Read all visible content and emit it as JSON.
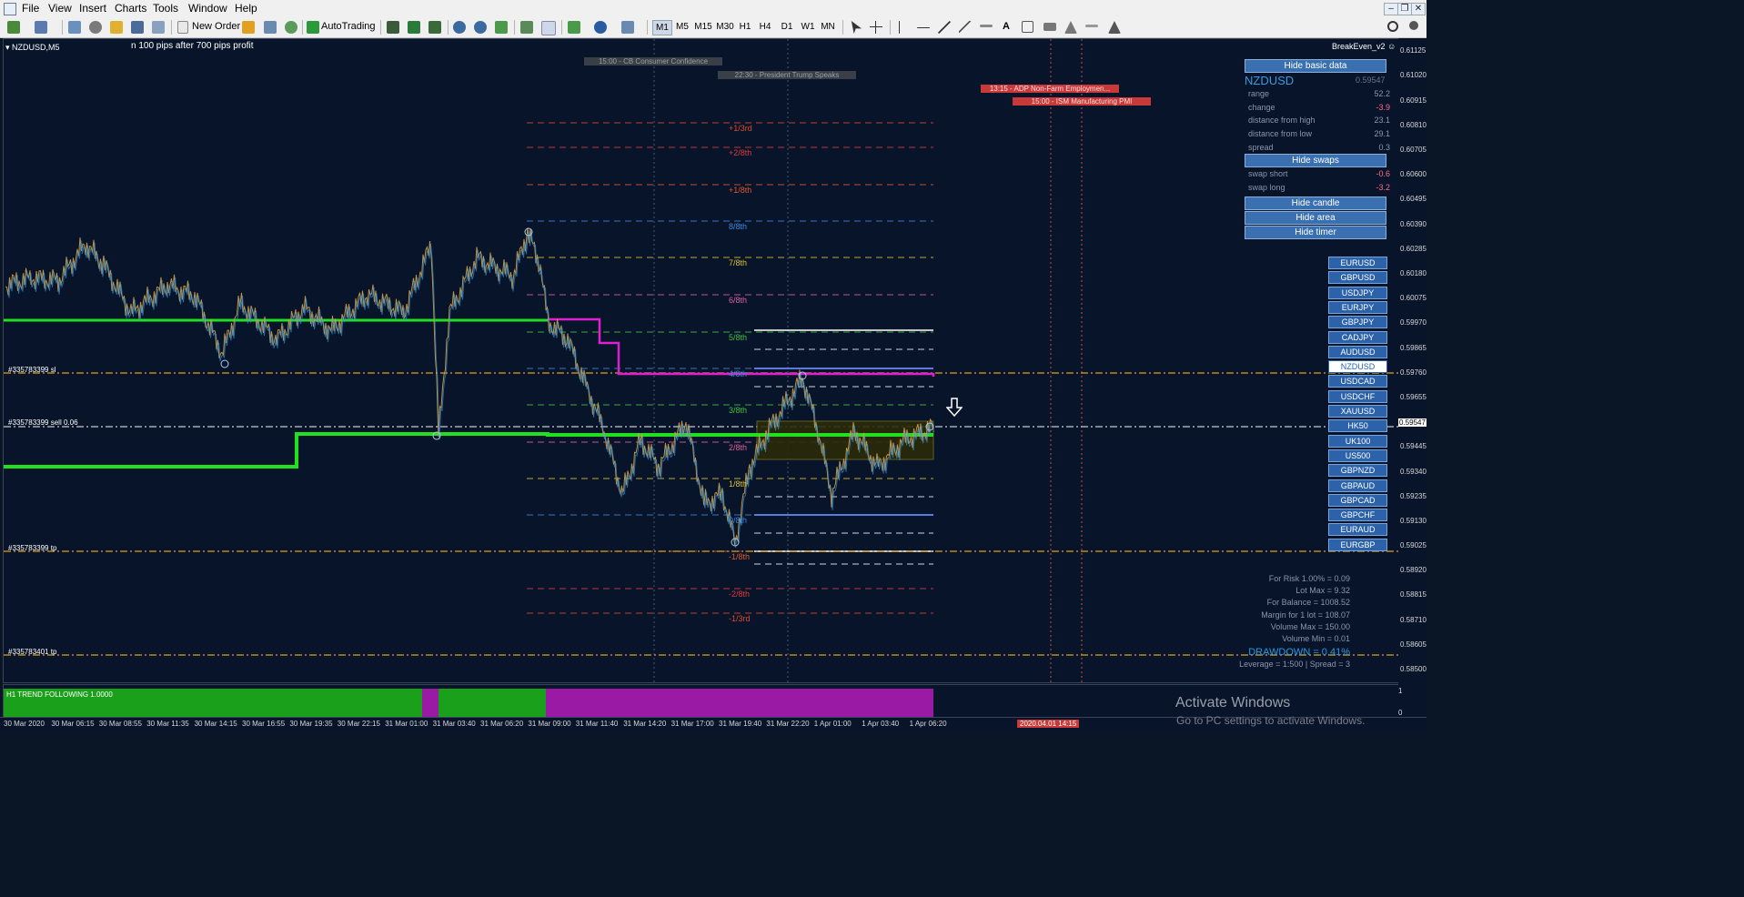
{
  "menubar": {
    "items": [
      "File",
      "View",
      "Insert",
      "Charts",
      "Tools",
      "Window",
      "Help"
    ]
  },
  "toolbar": {
    "new_order": "New Order",
    "autotrading": "AutoTrading",
    "timeframes": [
      "M1",
      "M5",
      "M15",
      "M30",
      "H1",
      "H4",
      "D1",
      "W1",
      "MN"
    ]
  },
  "chart": {
    "symbol_label": "NZDUSD,M5",
    "comment": "n 100 pips after 700 pips profit",
    "indicator_name": "BreakEven_v2",
    "order_labels": {
      "sl": "#335783399 sl",
      "sell": "#335783399 sell 0.06",
      "tp1": "#335783399 tp",
      "tp2": "#335783401 tp"
    },
    "events": [
      {
        "text": "15:00 - CB Consumer Confidence",
        "color": "#3a3f47",
        "text_color": "#9aa0a8"
      },
      {
        "text": "22:30 - President Trump Speaks",
        "color": "#3a3f47",
        "text_color": "#9aa0a8"
      },
      {
        "text": "13:15 - ADP Non-Farm Employmen...",
        "color": "#c83a3a",
        "text_color": "#ffdede"
      },
      {
        "text": "15:00 - ISM Manufacturing PMI",
        "color": "#c83a3a",
        "text_color": "#ffdede"
      }
    ],
    "fib_levels": [
      {
        "label": "+1/3rd",
        "color": "#e04a2a"
      },
      {
        "label": "+2/8th",
        "color": "#e03a3a"
      },
      {
        "label": "+1/8th",
        "color": "#e05a2a"
      },
      {
        "label": "8/8th",
        "color": "#3a8ae0"
      },
      {
        "label": "7/8th",
        "color": "#e0c030"
      },
      {
        "label": "6/8th",
        "color": "#e060a0"
      },
      {
        "label": "5/8th",
        "color": "#40c040"
      },
      {
        "label": "4/8th",
        "color": "#3a8ae0"
      },
      {
        "label": "3/8th",
        "color": "#40c040"
      },
      {
        "label": "2/8th",
        "color": "#e060a0"
      },
      {
        "label": "1/8th",
        "color": "#e0c030"
      },
      {
        "label": "0/8th",
        "color": "#3a8ae0"
      },
      {
        "label": "-1/8th",
        "color": "#e05a2a"
      },
      {
        "label": "-2/8th",
        "color": "#e03a3a"
      },
      {
        "label": "-1/3rd",
        "color": "#e04a2a"
      }
    ],
    "price_axis": [
      "0.61125",
      "0.61020",
      "0.60915",
      "0.60810",
      "0.60705",
      "0.60600",
      "0.60495",
      "0.60390",
      "0.60285",
      "0.60180",
      "0.60075",
      "0.59970",
      "0.59865",
      "0.59760",
      "0.59655",
      "0.59547",
      "0.59445",
      "0.59340",
      "0.59235",
      "0.59130",
      "0.59025",
      "0.58920",
      "0.58815",
      "0.58710",
      "0.58605",
      "0.58500"
    ],
    "current_price": "0.59547",
    "time_axis": [
      "30 Mar 2020",
      "30 Mar 06:15",
      "30 Mar 08:55",
      "30 Mar 11:35",
      "30 Mar 14:15",
      "30 Mar 16:55",
      "30 Mar 19:35",
      "30 Mar 22:15",
      "31 Mar 01:00",
      "31 Mar 03:40",
      "31 Mar 06:20",
      "31 Mar 09:00",
      "31 Mar 11:40",
      "31 Mar 14:20",
      "31 Mar 17:00",
      "31 Mar 19:40",
      "31 Mar 22:20",
      "1 Apr 01:00",
      "1 Apr 03:40",
      "1 Apr 06:20"
    ],
    "time_cursor_label": "2020.04.01 14:15",
    "right_axis_extra": [
      "1",
      "0"
    ]
  },
  "panel": {
    "hide_basic_data": "Hide basic data",
    "symbol": "NZDUSD",
    "symbol_price": "0.59547",
    "stats": [
      {
        "label": "range",
        "value": "52.2",
        "color": "#8a96a8"
      },
      {
        "label": "change",
        "value": "-3.9",
        "color": "#ff6a8a"
      },
      {
        "label": "distance from high",
        "value": "23.1",
        "color": "#8a96a8"
      },
      {
        "label": "distance from low",
        "value": "29.1",
        "color": "#8a96a8"
      },
      {
        "label": "spread",
        "value": "0.3",
        "color": "#8a96a8"
      }
    ],
    "hide_swaps": "Hide swaps",
    "swaps": [
      {
        "label": "swap short",
        "value": "-0.6",
        "color": "#ff6a8a"
      },
      {
        "label": "swap long",
        "value": "-3.2",
        "color": "#ff6a8a"
      }
    ],
    "hide_candle": "Hide candle",
    "hide_area": "Hide area",
    "hide_timer": "Hide timer",
    "symbols": [
      "EURUSD",
      "GBPUSD",
      "USDJPY",
      "EURJPY",
      "GBPJPY",
      "CADJPY",
      "AUDUSD",
      "NZDUSD",
      "USDCAD",
      "USDCHF",
      "XAUUSD",
      "HK50",
      "UK100",
      "US500",
      "GBPNZD",
      "GBPAUD",
      "GBPCAD",
      "GBPCHF",
      "EURAUD",
      "EURGBP"
    ],
    "active_symbol": "NZDUSD"
  },
  "risk": {
    "lines": [
      "For Risk 1.00% = 0.09",
      "Lot Max = 9.32",
      "For Balance = 1008.52",
      "Margin for 1 lot = 108.07",
      "Volume Max = 150.00",
      "Volume Min = 0.01"
    ],
    "drawdown": "DRAWDOWN = 0.41%",
    "leverage": "Leverage = 1:500 | Spread = 3"
  },
  "indicator_panel": {
    "label": "H1 TREND FOLLOWING 1.0000"
  },
  "watermark": {
    "title": "Activate Windows",
    "subtitle": "Go to PC settings to activate Windows."
  }
}
